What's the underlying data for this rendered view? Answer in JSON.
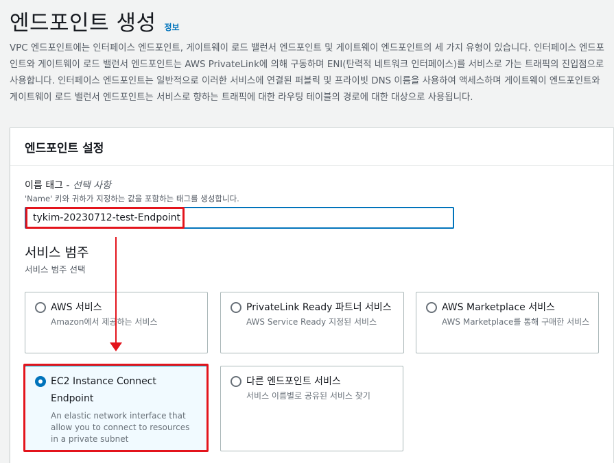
{
  "header": {
    "title": "엔드포인트 생성",
    "info_link": "정보",
    "description": "VPC 엔드포인트에는 인터페이스 엔드포인트, 게이트웨이 로드 밸런서 엔드포인트 및 게이트웨이 엔드포인트의 세 가지 유형이 있습니다. 인터페이스 엔드포인트와 게이트웨이 로드 밸런서 엔드포인트는 AWS PrivateLink에 의해 구동하며 ENI(탄력적 네트워크 인터페이스)를 서비스로 가는 트래픽의 진입점으로 사용합니다. 인터페이스 엔드포인트는 일반적으로 이러한 서비스에 연결된 퍼블릭 및 프라이빗 DNS 이름을 사용하여 액세스하며 게이트웨이 엔드포인트와 게이트웨이 로드 밸런서 엔드포인트는 서비스로 향하는 트래픽에 대한 라우팅 테이블의 경로에 대한 대상으로 사용됩니다."
  },
  "settings": {
    "title": "엔드포인트 설정",
    "name_tag": {
      "label": "이름 태그 - ",
      "optional": "선택 사항",
      "description": "'Name' 키와 귀하가 지정하는 값을 포함하는 태그를 생성합니다.",
      "value": "tykim-20230712-test-Endpoint"
    },
    "service_category": {
      "title": "서비스 범주",
      "description": "서비스 범주 선택",
      "options": [
        {
          "title": "AWS 서비스",
          "description": "Amazon에서 제공하는 서비스",
          "selected": false
        },
        {
          "title": "PrivateLink Ready 파트너 서비스",
          "description": "AWS Service Ready 지정된 서비스",
          "selected": false
        },
        {
          "title": "AWS Marketplace 서비스",
          "description": "AWS Marketplace를 통해 구매한 서비스",
          "selected": false
        },
        {
          "title": "EC2 Instance Connect Endpoint",
          "description": "An elastic network interface that allow you to connect to resources in a private subnet",
          "selected": true
        },
        {
          "title": "다른 엔드포인트 서비스",
          "description": "서비스 이름별로 공유된 서비스 찾기",
          "selected": false
        }
      ]
    }
  },
  "colors": {
    "accent": "#0073bb",
    "annotation": "#e3141c",
    "selected_bg": "#f1faff"
  }
}
